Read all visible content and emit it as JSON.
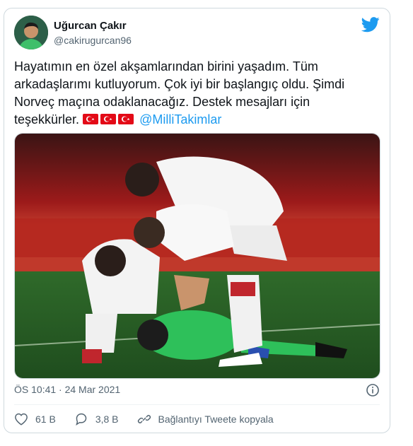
{
  "user": {
    "name": "Uğurcan Çakır",
    "handle": "@cakirugurcan96"
  },
  "tweet": {
    "text_line1": "Hayatımın en özel akşamlarından birini yaşadım. Tüm",
    "text_line2": "arkadaşlarımı kutluyorum. Çok iyi bir başlangıç oldu. Şimdi",
    "text_line3": "Norveç maçına odaklanacağız. Destek mesajları için",
    "text_line4_start": "teşekkürler.",
    "mention": "@MilliTakimlar",
    "timestamp": "ÖS 10:41 · 24 Mar 2021"
  },
  "actions": {
    "likes": "61 B",
    "replies": "3,8 B",
    "copy_link": "Bağlantıyı Tweete kopyala"
  },
  "colors": {
    "accent": "#1d9bf0",
    "muted": "#536471",
    "flag_red": "#e30a17"
  },
  "icons": [
    "twitter-bird-icon",
    "info-icon",
    "heart-icon",
    "reply-icon",
    "link-icon",
    "turkish-flag-icon"
  ]
}
